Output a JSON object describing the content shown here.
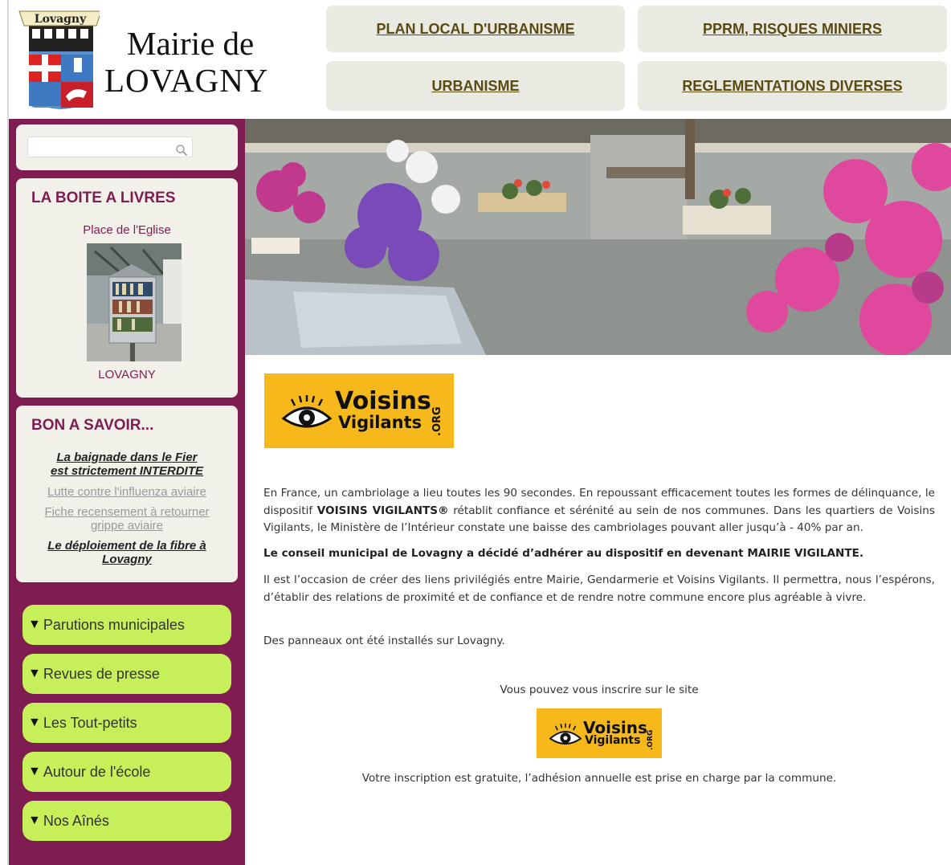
{
  "header": {
    "crest_banner": "Lovagny",
    "title_line1": "Mairie de",
    "title_line2": "LOVAGNY",
    "nav": [
      {
        "label": "PLAN LOCAL D'URBANISME"
      },
      {
        "label": "PPRM, RISQUES MINIERS"
      },
      {
        "label": "URBANISME"
      },
      {
        "label": "REGLEMENTATIONS DIVERSES"
      }
    ]
  },
  "sidebar": {
    "search": {
      "value": "",
      "placeholder": ""
    },
    "boite": {
      "title": "LA BOITE A LIVRES",
      "place": "Place de l'Eglise",
      "caption": "LOVAGNY"
    },
    "bon": {
      "title": "BON A SAVOIR...",
      "items": [
        {
          "line1": "La baignade dans le Fier",
          "line2": "est strictement INTERDITE"
        },
        {
          "line1": "Lutte contre l'influenza aviaire"
        },
        {
          "line1": "Fiche recensement à retourner",
          "line2": "grippe aviaire"
        },
        {
          "line1": "Le déploiement de la fibre à",
          "line2": "Lovagny"
        }
      ]
    },
    "menu": [
      {
        "label": "Parutions municipales"
      },
      {
        "label": "Revues de presse"
      },
      {
        "label": "Les Tout-petits"
      },
      {
        "label": "Autour de l'école"
      },
      {
        "label": "Nos Aînés"
      }
    ]
  },
  "main": {
    "logo": {
      "line1": "Voisins",
      "line2": "Vigilants",
      "suffix": ".ORG"
    },
    "p1_a": "En France, un cambriolage a lieu toutes les 90 secondes. En repoussant efficacement toutes les formes de délinquance, le dispositif ",
    "p1_bold": "VOISINS VIGILANTS®",
    "p1_b": " rétablit confiance et sérénité au sein de nos communes. Dans les quartiers de Voisins Vigilants, le Ministère de l’Intérieur constate une baisse des cambriolages pouvant aller jusqu’à - 40% par an.",
    "p2": "Le conseil municipal de Lovagny a décidé d’adhérer au dispositif en devenant MAIRIE VIGILANTE.",
    "p3": "Il est l’occasion de créer des liens privilégiés entre Mairie, Gendarmerie et Voisins Vigilants. Il permettra, nous l’espérons, d’établir des relations de proximité et de confiance et de rendre notre commune encore plus agréable à vivre.",
    "p4": "Des panneaux ont été installés sur Lovagny.",
    "inscription": "Vous pouvez vous inscrire sur le site",
    "gratuit": "Votre inscription est gratuite, l’adhésion annuelle est prise en charge par la commune."
  },
  "colors": {
    "sidebar": "#7f1d52",
    "menu": "#c6ef5a",
    "nav_box": "#e9ebe3",
    "logo_bg": "#f6b81b"
  }
}
